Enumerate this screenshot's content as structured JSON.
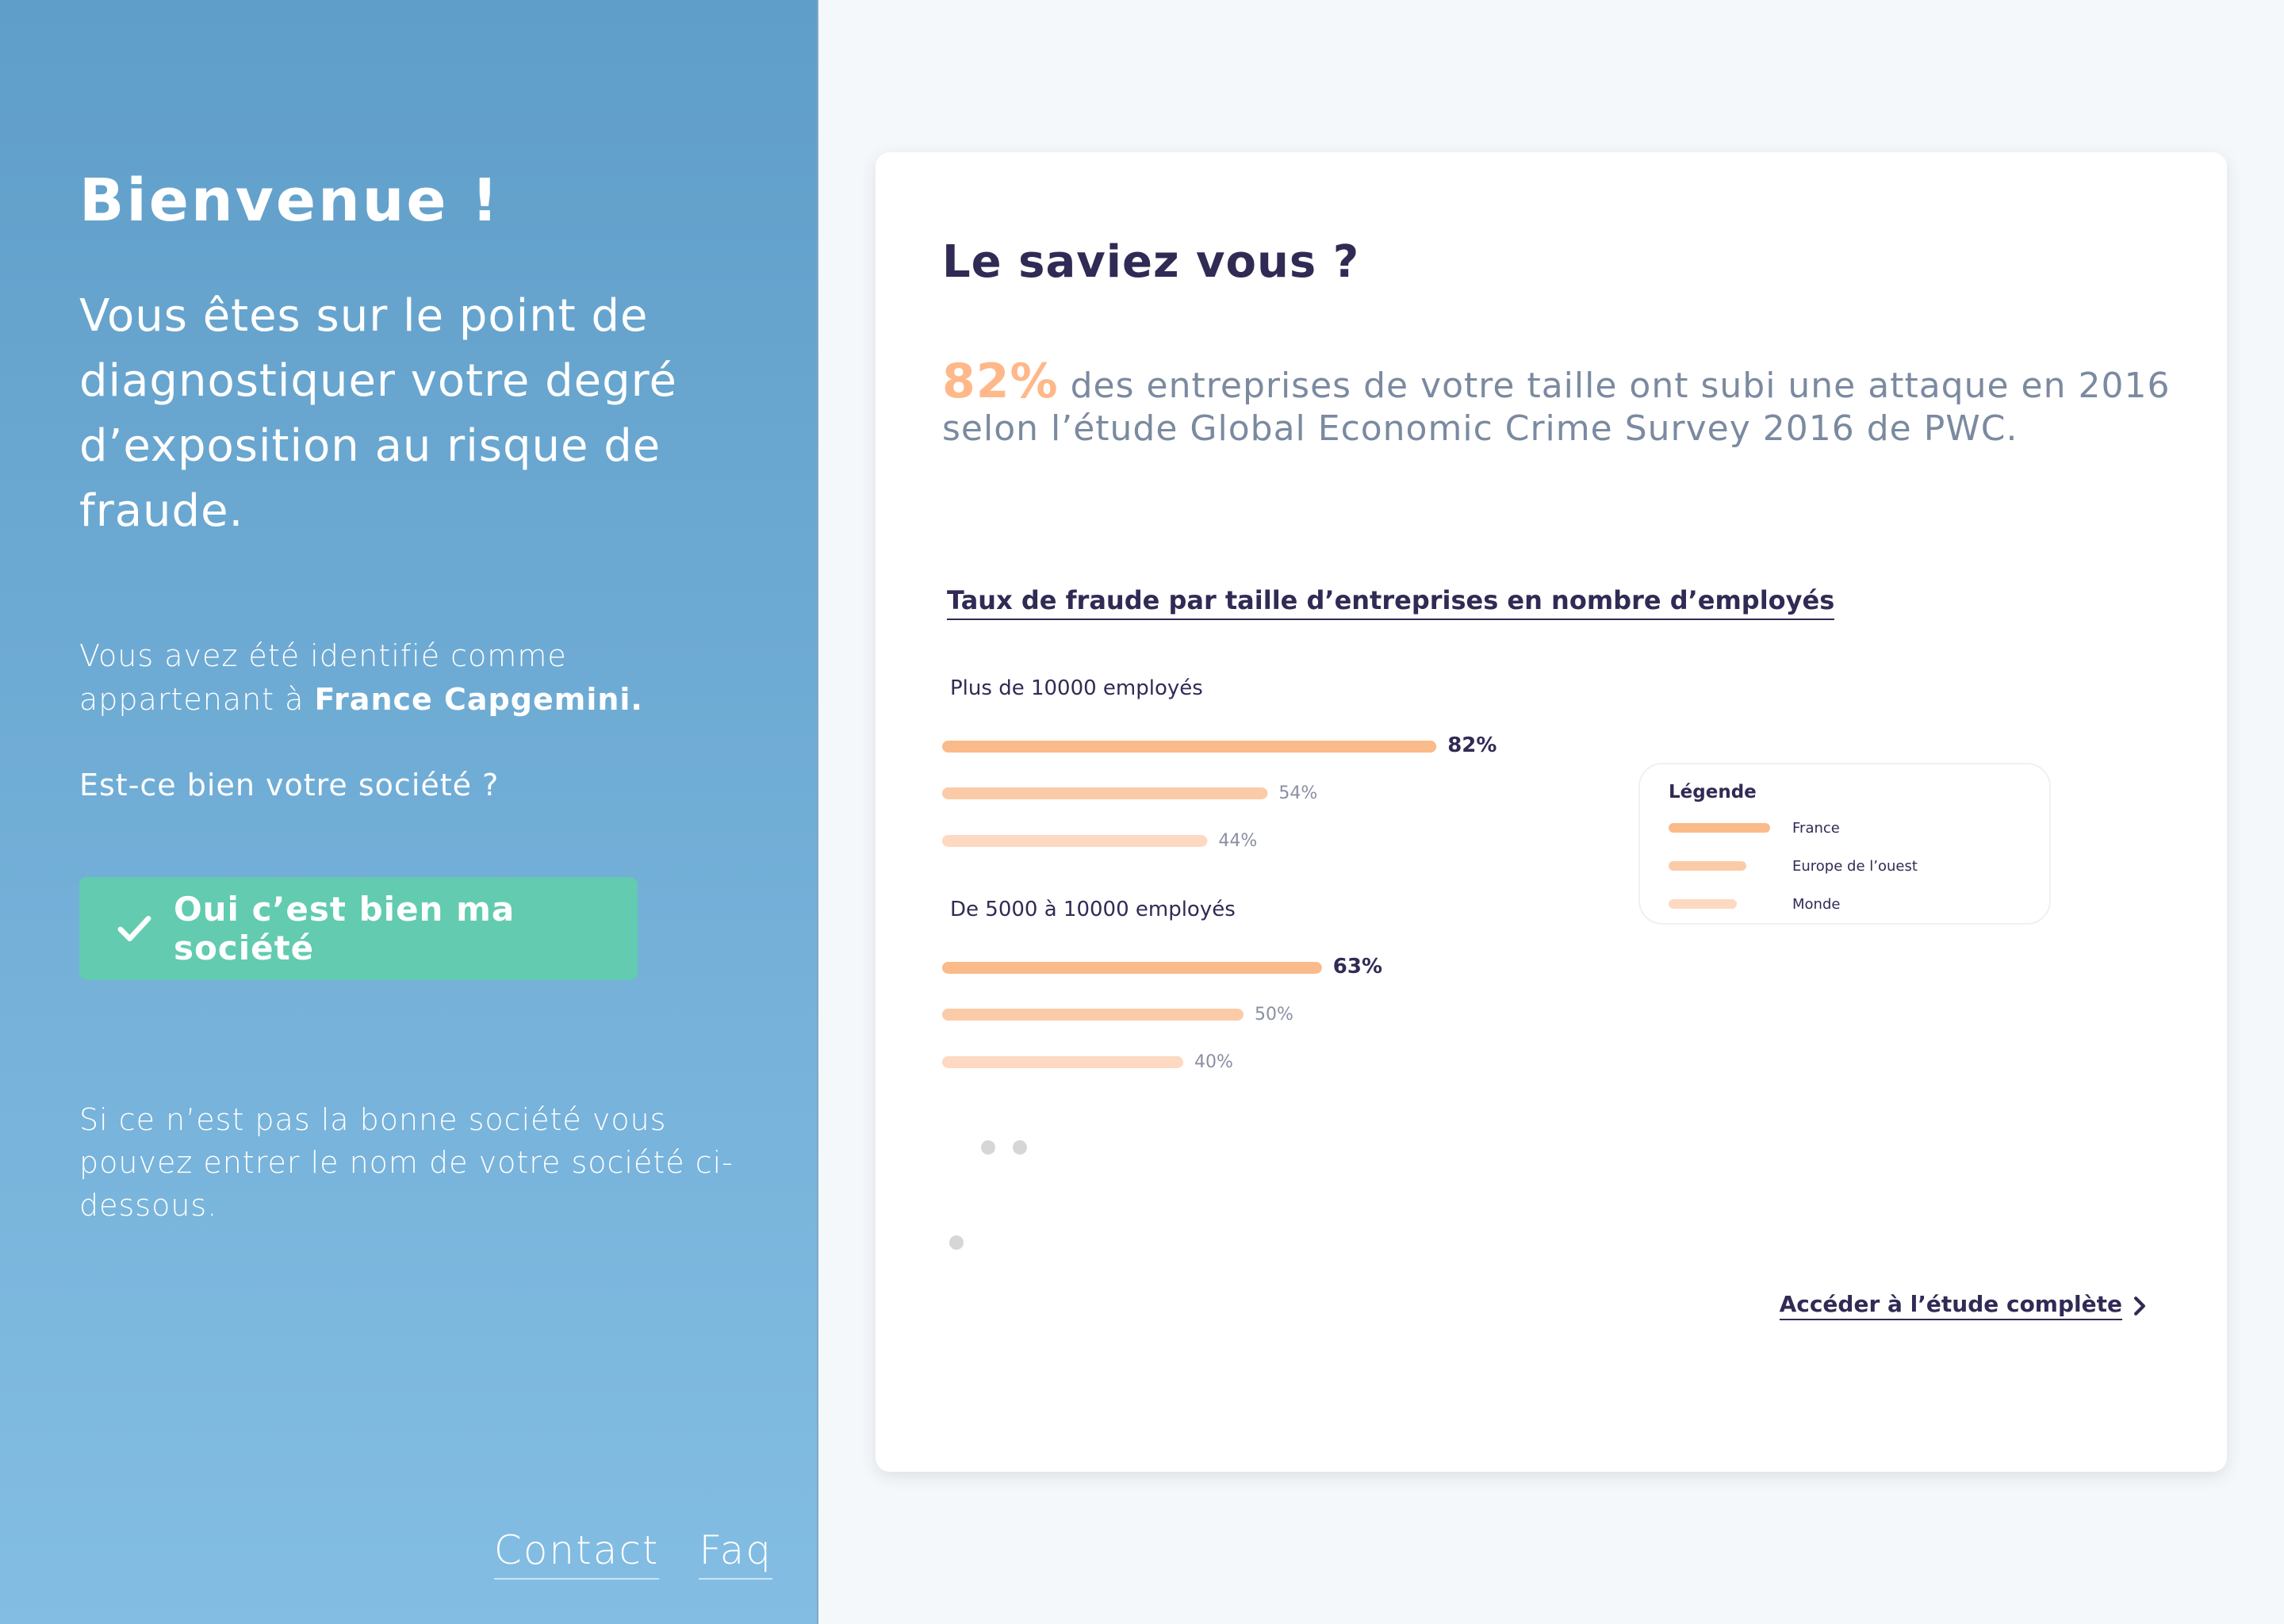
{
  "left": {
    "welcome": "Bienvenue !",
    "intro": "Vous êtes sur le point de diagnostiquer votre degré d’exposition au risque de fraude.",
    "identified_prefix": "Vous avez été identifié comme appartenant à",
    "company": "France Capgemini.",
    "question": "Est-ce bien votre société ?",
    "confirm_label": "Oui c’est bien ma société",
    "wrong_company": "Si ce n’est pas la bonne société vous pouvez entrer le nom de votre société ci-dessous.",
    "footer": {
      "contact": "Contact",
      "faq": "Faq"
    }
  },
  "card": {
    "title": "Le saviez vous ?",
    "fact_value": "82%",
    "fact_text": "des entreprises de votre taille ont subi une attaque en 2016 selon l’étude Global Economic Crime Survey 2016 de PWC.",
    "study_link": "Accéder à l’étude complète"
  },
  "colors": {
    "accent": "#ffb88a",
    "navy": "#302b55",
    "green": "#62cbb0",
    "blue": "#5f9ec9"
  },
  "chart_data": {
    "type": "bar",
    "orientation": "horizontal",
    "title": "Taux de fraude par taille d’entreprises en nombre d’employés",
    "categories": [
      "Plus de 10000 employés",
      "De 5000 à 10000 employés"
    ],
    "series": [
      {
        "name": "France",
        "values": [
          82,
          63
        ],
        "labels": [
          "82%",
          "63%"
        ],
        "color": "#fbba8a"
      },
      {
        "name": "Europe de l’ouest",
        "values": [
          54,
          50
        ],
        "labels": [
          "54%",
          "50%"
        ],
        "color": "#fbcba8"
      },
      {
        "name": "Monde",
        "values": [
          44,
          40
        ],
        "labels": [
          "44%",
          "40%"
        ],
        "color": "#fdd9c2"
      }
    ],
    "legend_title": "Légende",
    "legend_position": "right"
  }
}
